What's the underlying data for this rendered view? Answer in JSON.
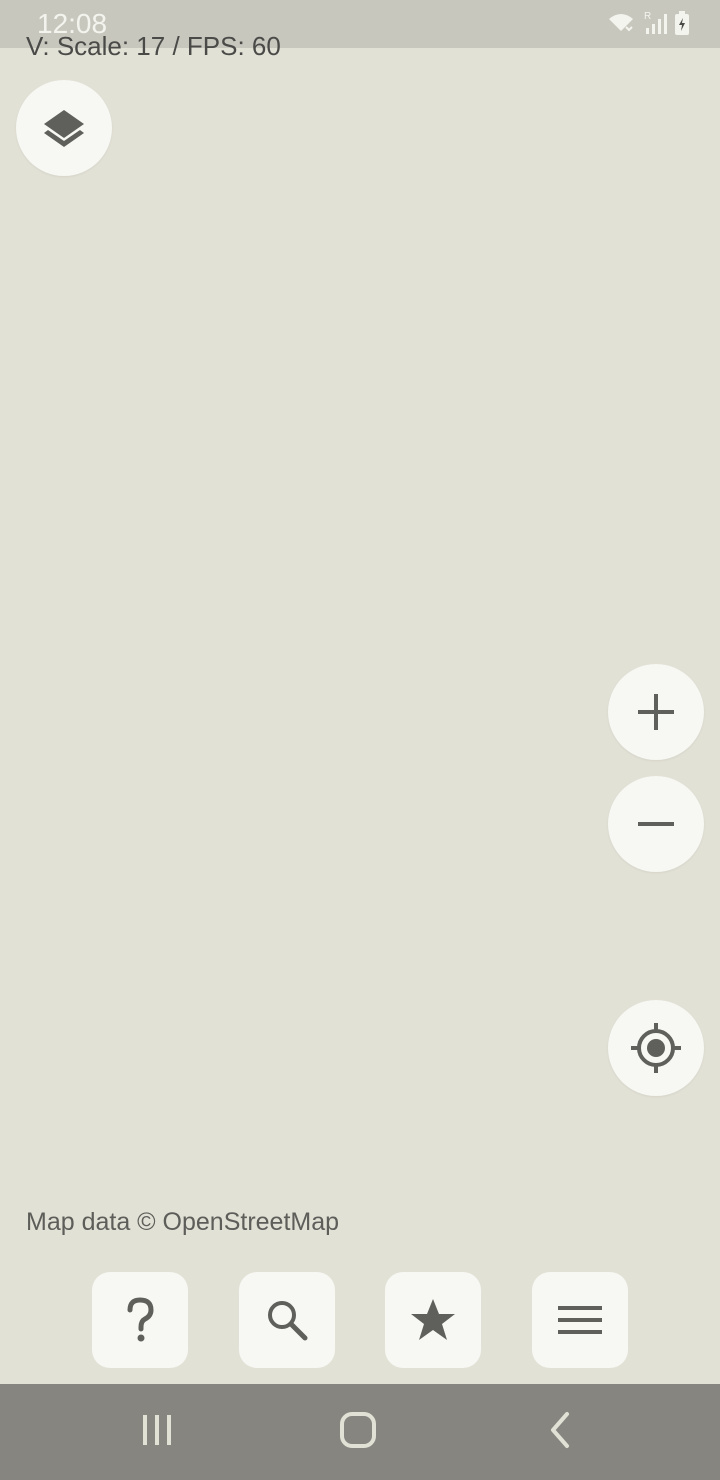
{
  "status_bar": {
    "time": "12:08",
    "icons": [
      "wifi-icon",
      "signal-roaming-icon",
      "battery-charging-icon"
    ]
  },
  "debug": {
    "text": "V: Scale: 17 / FPS: 60"
  },
  "map": {
    "attribution": "Map data © OpenStreetMap",
    "background_color": "#e2e1d5",
    "controls": {
      "layers": "layers-icon",
      "zoom_in": "plus-icon",
      "zoom_out": "minus-icon",
      "my_location": "crosshair-location-icon"
    }
  },
  "toolbar": {
    "buttons": [
      {
        "name": "help",
        "icon": "question-mark-icon"
      },
      {
        "name": "search",
        "icon": "search-icon"
      },
      {
        "name": "favorites",
        "icon": "star-icon"
      },
      {
        "name": "menu",
        "icon": "hamburger-menu-icon"
      }
    ]
  },
  "nav_bar": {
    "buttons": [
      "recents-icon",
      "home-icon",
      "back-icon"
    ]
  },
  "colors": {
    "icon": "#5f5f5c",
    "button_bg": "#f7f7f3",
    "status_bar": "#c8c7bd",
    "nav_bar": "#868580"
  }
}
